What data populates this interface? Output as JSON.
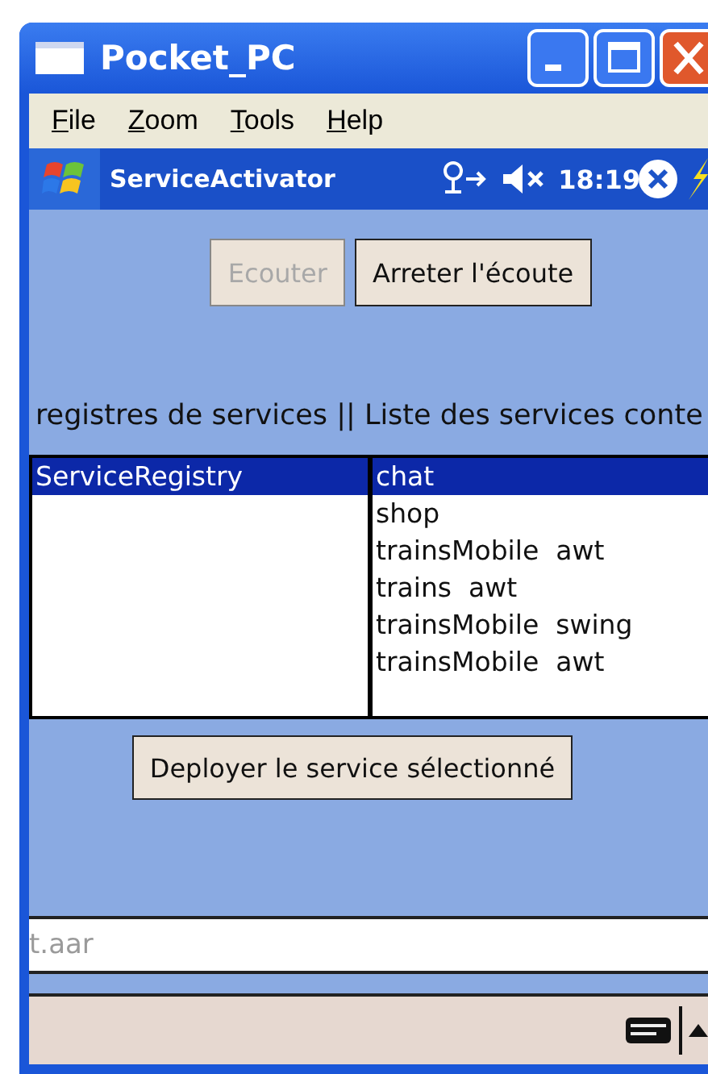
{
  "window": {
    "title": "Pocket_PC"
  },
  "menu": [
    {
      "label": "File"
    },
    {
      "label": "Zoom"
    },
    {
      "label": "Tools"
    },
    {
      "label": "Help"
    }
  ],
  "nav_bar": {
    "title": "ServiceActivator",
    "time": "18:19"
  },
  "buttons": [
    {
      "label": "Ecouter",
      "disabled": true
    },
    {
      "label": "Arreter l'écoute",
      "disabled": false
    }
  ],
  "header_label": "registres de services || Liste des services conte",
  "registries": [
    {
      "label": "ServiceRegistry",
      "selected": true
    }
  ],
  "services": [
    {
      "label": "chat",
      "selected": true
    },
    {
      "label": "shop",
      "selected": false
    },
    {
      "label": "trainsMobile  awt",
      "selected": false
    },
    {
      "label": "trains  awt",
      "selected": false
    },
    {
      "label": "trainsMobile  swing",
      "selected": false
    },
    {
      "label": "trainsMobile  awt",
      "selected": false
    }
  ],
  "deploy_button": {
    "label": "Deployer le service sélectionné"
  },
  "file_field": {
    "value": "t.aar"
  }
}
